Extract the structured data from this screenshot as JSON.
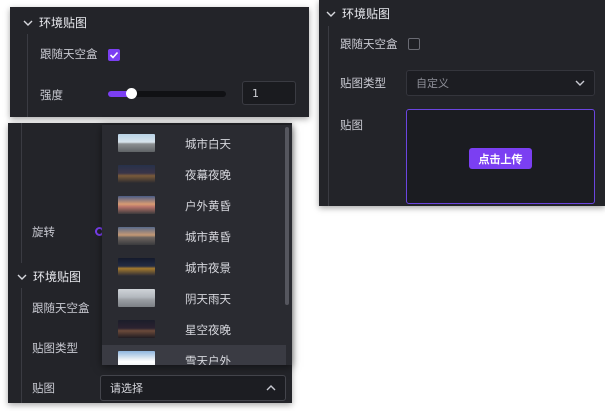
{
  "panel_a": {
    "header": "环境贴图",
    "follow_skybox_label": "跟随天空盒",
    "follow_skybox_checked": true,
    "intensity_label": "强度",
    "intensity_value": "1",
    "intensity_fraction": 0.2
  },
  "panel_b": {
    "header": "环境贴图",
    "follow_skybox_label": "跟随天空盒",
    "follow_skybox_checked": false,
    "map_type_label": "贴图类型",
    "map_type_value": "自定义",
    "map_label": "贴图",
    "upload_button": "点击上传"
  },
  "panel_c": {
    "rotate_label": "旋转",
    "header": "环境贴图",
    "follow_skybox_label": "跟随天空盒",
    "map_type_label": "贴图类型",
    "map_label": "贴图",
    "select_placeholder": "请选择",
    "options": [
      {
        "label": "城市白天",
        "thumb": "city-day"
      },
      {
        "label": "夜幕夜晚",
        "thumb": "night"
      },
      {
        "label": "户外黄昏",
        "thumb": "outdoor-dusk"
      },
      {
        "label": "城市黄昏",
        "thumb": "city-dusk"
      },
      {
        "label": "城市夜景",
        "thumb": "city-night"
      },
      {
        "label": "阴天雨天",
        "thumb": "overcast"
      },
      {
        "label": "星空夜晚",
        "thumb": "starry"
      },
      {
        "label": "雪天户外",
        "thumb": "snow"
      }
    ],
    "highlighted_index": 7
  },
  "colors": {
    "accent": "#7b3ff2",
    "panel_bg": "#232429"
  }
}
